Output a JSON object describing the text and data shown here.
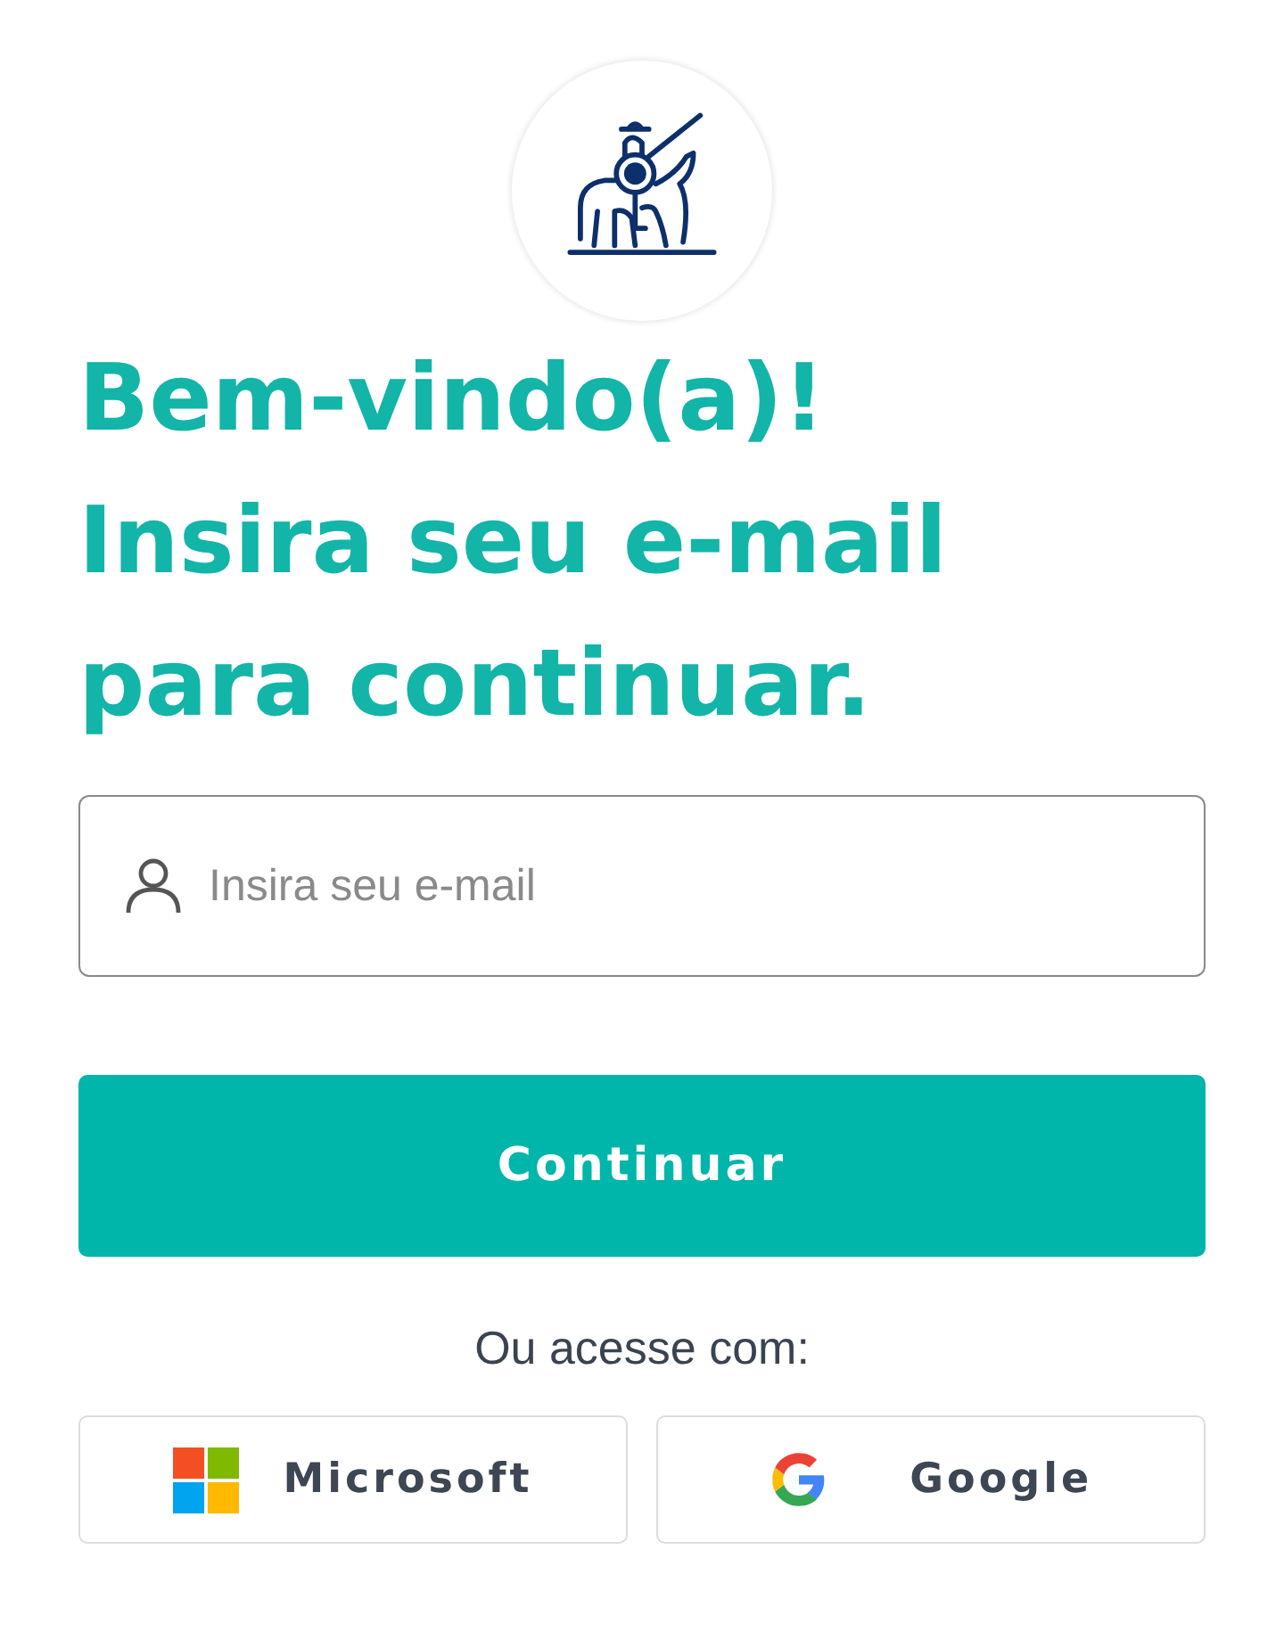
{
  "heading": {
    "lines": [
      "Bem-vindo(a)!",
      "Insira seu e-mail",
      "para continuar."
    ]
  },
  "email_field": {
    "placeholder": "Insira seu e-mail"
  },
  "continue_button": {
    "label": "Continuar"
  },
  "alt_login_label": "Ou acesse com:",
  "social_buttons": [
    {
      "kind": "microsoft",
      "label": "Microsoft"
    },
    {
      "kind": "google",
      "label": "Google"
    }
  ]
}
